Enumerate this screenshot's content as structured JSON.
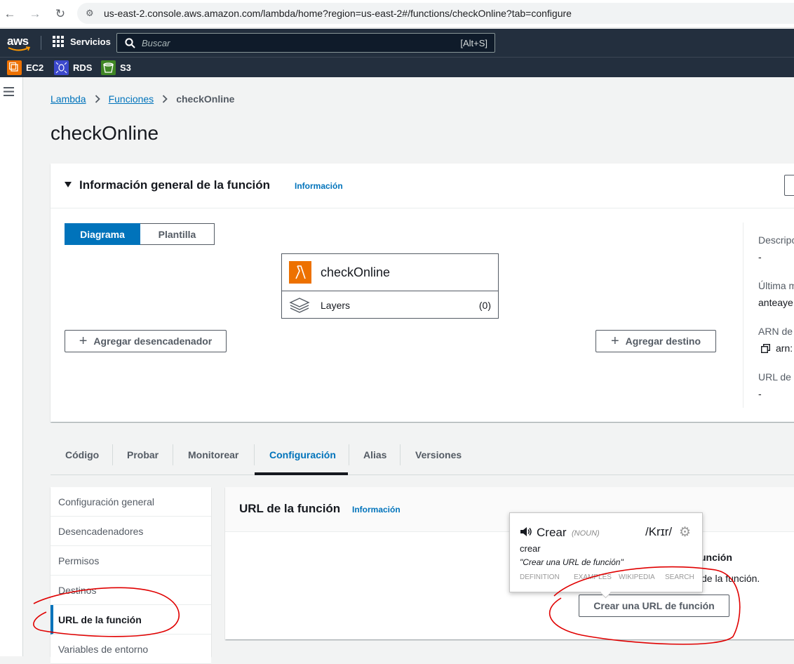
{
  "browser": {
    "url": "us-east-2.console.aws.amazon.com/lambda/home?region=us-east-2#/functions/checkOnline?tab=configure"
  },
  "topnav": {
    "logo": "aws",
    "services_label": "Servicios",
    "search_placeholder": "Buscar",
    "search_shortcut": "[Alt+S]"
  },
  "favorites": [
    {
      "label": "EC2",
      "color": "#ed7100"
    },
    {
      "label": "RDS",
      "color": "#3b48cc"
    },
    {
      "label": "S3",
      "color": "#3f8624"
    }
  ],
  "breadcrumb": {
    "lambda": "Lambda",
    "functions": "Funciones",
    "current": "checkOnline"
  },
  "page_title": "checkOnline",
  "overview": {
    "title": "Información general de la función",
    "info": "Información",
    "toggle_diagram": "Diagrama",
    "toggle_template": "Plantilla",
    "function_name": "checkOnline",
    "layers_label": "Layers",
    "layers_count": "(0)",
    "add_trigger": "Agregar desencadenador",
    "add_destination": "Agregar destino",
    "side": {
      "desc_label": "Descripc",
      "desc_value": "-",
      "last_label": "Última m",
      "last_value": "anteaye",
      "arn_label": "ARN de",
      "arn_value": "arn:",
      "url_label": "URL de l",
      "url_value": "-"
    }
  },
  "tabs": [
    "Código",
    "Probar",
    "Monitorear",
    "Configuración",
    "Alias",
    "Versiones"
  ],
  "active_tab": "Configuración",
  "config_nav": [
    "Configuración general",
    "Desencadenadores",
    "Permisos",
    "Destinos",
    "URL de la función",
    "Variables de entorno"
  ],
  "function_url": {
    "title": "URL de la función",
    "info": "Información",
    "heading_fragment": "unción",
    "text_fragment": "de la función.",
    "create_button": "Crear una URL de función"
  },
  "dictionary_popup": {
    "word": "Crear",
    "pos": "(NOUN)",
    "pronunciation": "/Krɪr/",
    "meaning": "crear",
    "example": "\"Crear una URL de función\"",
    "links": [
      "DEFINITION",
      "EXAMPLES",
      "WIKIPEDIA",
      "SEARCH"
    ]
  },
  "colors": {
    "accent": "#0073bb",
    "aws_dark": "#232f3e",
    "lambda_orange": "#ed7100",
    "annotation": "#e00000"
  }
}
